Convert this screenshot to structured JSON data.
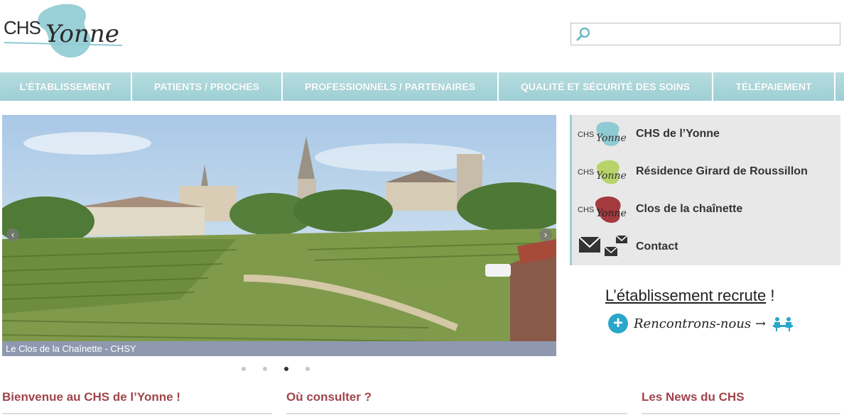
{
  "header": {
    "logo_chs": "CHS",
    "logo_yonne": "Yonne",
    "search_placeholder": "",
    "search_value": ""
  },
  "nav": {
    "items": [
      {
        "label": "L’ÉTABLISSEMENT"
      },
      {
        "label": "PATIENTS / PROCHES"
      },
      {
        "label": "PROFESSIONNELS / PARTENAIRES"
      },
      {
        "label": "QUALITÉ ET SÉCURITÉ DES SOINS"
      },
      {
        "label": "TÉLÉPAIEMENT"
      }
    ]
  },
  "slider": {
    "caption": "Le Clos de la Chaînette - CHSY",
    "prev_glyph": "‹",
    "next_glyph": "›",
    "slide_count": 4,
    "active_slide": 3
  },
  "sidebar": {
    "links": [
      {
        "label": "CHS de l’Yonne",
        "logo_chs": "CHS",
        "logo_yonne": "Yonne",
        "color": "#8fcbd3"
      },
      {
        "label": "Résidence Girard de Roussillon",
        "logo_chs": "CHS",
        "logo_yonne": "Yonne",
        "color": "#b8d36a"
      },
      {
        "label": "Clos de la chaînette",
        "logo_chs": "CHS",
        "logo_yonne": "Yonne",
        "color": "#a33a3e"
      },
      {
        "label": "Contact"
      }
    ]
  },
  "recruit": {
    "title_underlined": "L’établissement recrute",
    "title_suffix": " !",
    "meet": "Rencontrons-nous →"
  },
  "sections": [
    {
      "title": "Bienvenue au CHS de l’Yonne !"
    },
    {
      "title": "Où consulter ?"
    },
    {
      "title": "Les News du CHS"
    }
  ],
  "colors": {
    "nav": "#9ccfd4",
    "heading": "#a0454a",
    "caption_bg": "#8e99b0",
    "accent_blue": "#29a6c9"
  }
}
